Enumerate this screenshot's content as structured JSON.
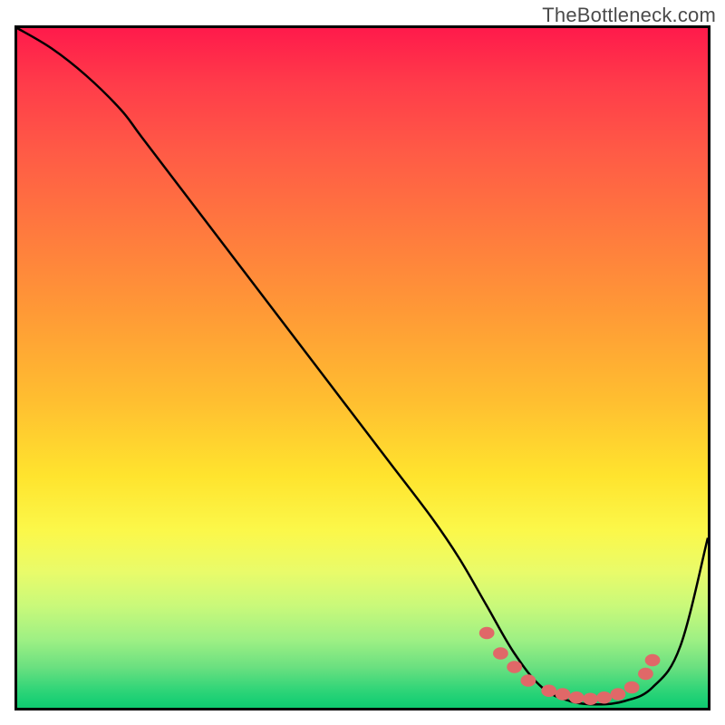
{
  "watermark": "TheBottleneck.com",
  "chart_data": {
    "type": "line",
    "title": "",
    "xlabel": "",
    "ylabel": "",
    "xlim": [
      0,
      100
    ],
    "ylim": [
      0,
      100
    ],
    "series": [
      {
        "name": "bottleneck-curve",
        "x": [
          0,
          5,
          10,
          15,
          18,
          24,
          30,
          36,
          42,
          48,
          54,
          60,
          64,
          68,
          72,
          76,
          80,
          84,
          88,
          92,
          96,
          100
        ],
        "y": [
          100,
          97,
          93,
          88,
          84,
          76,
          68,
          60,
          52,
          44,
          36,
          28,
          22,
          15,
          8,
          3,
          1,
          0.5,
          1,
          3,
          9,
          25
        ]
      }
    ],
    "markers": {
      "name": "highlight-dots",
      "x": [
        68,
        70,
        72,
        74,
        77,
        79,
        81,
        83,
        85,
        87,
        89,
        91,
        92
      ],
      "y": [
        11,
        8,
        6,
        4,
        2.5,
        2,
        1.5,
        1.3,
        1.5,
        2,
        3,
        5,
        7
      ]
    },
    "gradient_note": "background vertical gradient: red(top) to green(bottom), indicates higher=worse"
  }
}
